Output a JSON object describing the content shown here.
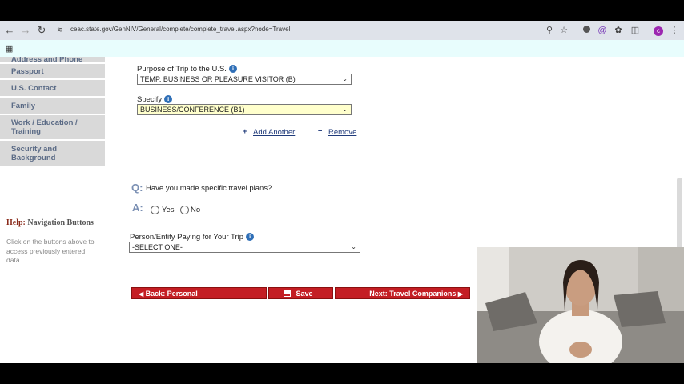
{
  "browser": {
    "url": "ceac.state.gov/GenNIV/General/complete/complete_travel.aspx?node=Travel",
    "profile_initial": "c",
    "colors": {
      "profile": "#9c27b0"
    }
  },
  "sidebar": {
    "items": [
      {
        "label": "Address and Phone"
      },
      {
        "label": "Passport"
      },
      {
        "label": "U.S. Contact"
      },
      {
        "label": "Family"
      },
      {
        "label": "Work / Education / Training"
      },
      {
        "label": "Security and Background"
      }
    ]
  },
  "help": {
    "title_prefix": "Help:",
    "title": "Navigation Buttons",
    "text": "Click on the buttons above to access previously entered data."
  },
  "form": {
    "purpose_label": "Purpose of Trip to the U.S.",
    "purpose_value": "TEMP. BUSINESS OR PLEASURE VISITOR (B)",
    "specify_label": "Specify",
    "specify_value": "BUSINESS/CONFERENCE (B1)",
    "add_another": "Add Another",
    "remove": "Remove",
    "q_marker": "Q:",
    "question": "Have you made specific travel plans?",
    "a_marker": "A:",
    "yes": "Yes",
    "no": "No",
    "paying_label": "Person/Entity Paying for Your Trip",
    "paying_value": "-SELECT ONE-"
  },
  "buttons": {
    "back": "Back: Personal",
    "save": "Save",
    "next": "Next: Travel Companions"
  },
  "colors": {
    "nav_button": "#c41e24",
    "specify_highlight": "#ffffcc",
    "sidebar_bg": "#d9d9d9"
  }
}
